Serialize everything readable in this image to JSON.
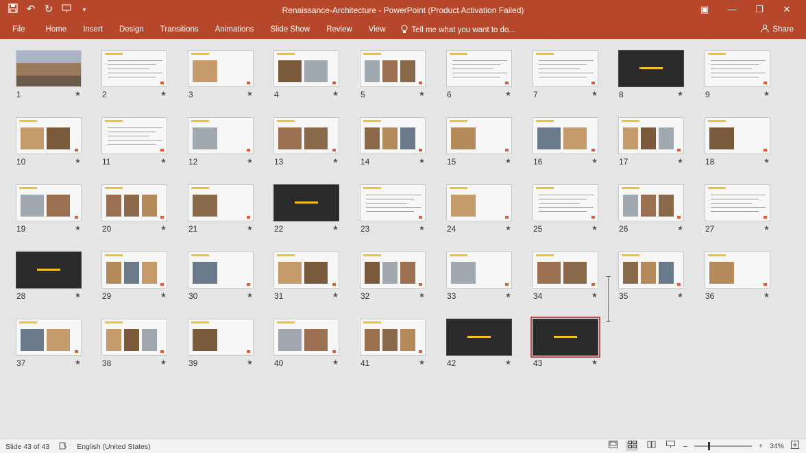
{
  "window": {
    "title": "Renaissance-Architecture - PowerPoint (Product Activation Failed)",
    "qat_icons": [
      "save-icon",
      "undo-icon",
      "redo-icon",
      "present-icon",
      "customize-icon"
    ],
    "controls": [
      "ribbon-display-icon",
      "minimize-icon",
      "restore-icon",
      "close-icon"
    ]
  },
  "ribbon": {
    "file": "File",
    "tabs": [
      "Home",
      "Insert",
      "Design",
      "Transitions",
      "Animations",
      "Slide Show",
      "Review",
      "View"
    ],
    "tell_me": "Tell me what you want to do...",
    "share": "Share"
  },
  "slides": [
    {
      "n": "1",
      "star": "★"
    },
    {
      "n": "2",
      "star": "★"
    },
    {
      "n": "3",
      "star": "★"
    },
    {
      "n": "4",
      "star": "★"
    },
    {
      "n": "5",
      "star": "★"
    },
    {
      "n": "6",
      "star": "★"
    },
    {
      "n": "7",
      "star": "★"
    },
    {
      "n": "8",
      "star": "★"
    },
    {
      "n": "9",
      "star": "★"
    },
    {
      "n": "10",
      "star": "★"
    },
    {
      "n": "11",
      "star": "★"
    },
    {
      "n": "12",
      "star": "★"
    },
    {
      "n": "13",
      "star": "★"
    },
    {
      "n": "14",
      "star": "★"
    },
    {
      "n": "15",
      "star": "★"
    },
    {
      "n": "16",
      "star": "★"
    },
    {
      "n": "17",
      "star": "★"
    },
    {
      "n": "18",
      "star": "★"
    },
    {
      "n": "19",
      "star": "★"
    },
    {
      "n": "20",
      "star": "★"
    },
    {
      "n": "21",
      "star": "★"
    },
    {
      "n": "22",
      "star": "★"
    },
    {
      "n": "23",
      "star": "★"
    },
    {
      "n": "24",
      "star": "★"
    },
    {
      "n": "25",
      "star": "★"
    },
    {
      "n": "26",
      "star": "★"
    },
    {
      "n": "27",
      "star": "★"
    },
    {
      "n": "28",
      "star": "★"
    },
    {
      "n": "29",
      "star": "★"
    },
    {
      "n": "30",
      "star": "★"
    },
    {
      "n": "31",
      "star": "★"
    },
    {
      "n": "32",
      "star": "★"
    },
    {
      "n": "33",
      "star": "★"
    },
    {
      "n": "34",
      "star": "★"
    },
    {
      "n": "35",
      "star": "★"
    },
    {
      "n": "36",
      "star": "★"
    },
    {
      "n": "37",
      "star": "★"
    },
    {
      "n": "38",
      "star": "★"
    },
    {
      "n": "39",
      "star": "★"
    },
    {
      "n": "40",
      "star": "★"
    },
    {
      "n": "41",
      "star": "★"
    },
    {
      "n": "42",
      "star": "★"
    },
    {
      "n": "43",
      "star": "★"
    }
  ],
  "dark_slides": [
    "8",
    "22",
    "28",
    "42",
    "43"
  ],
  "selected_slide": "43",
  "status": {
    "slide_info": "Slide 43 of 43",
    "language": "English (United States)",
    "zoom": "34%"
  },
  "colors": {
    "accent": "#b7472a",
    "title_bar": "#b7472a",
    "thumb_accent": "#f2c12e",
    "selection": "#c0504d"
  }
}
